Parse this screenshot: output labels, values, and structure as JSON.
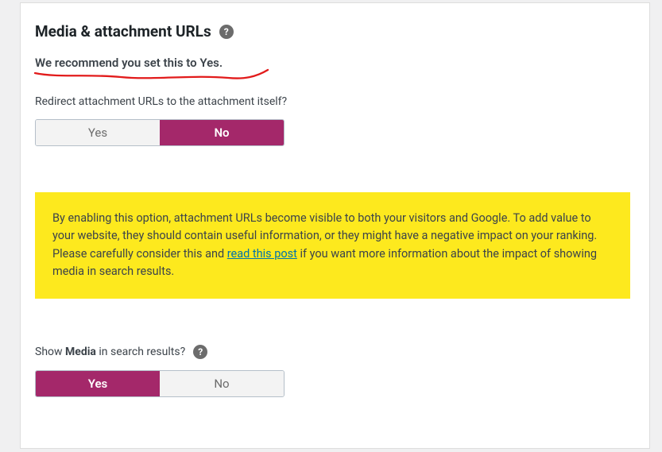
{
  "section": {
    "title": "Media & attachment URLs"
  },
  "recommend": "We recommend you set this to Yes.",
  "field1": {
    "label": "Redirect attachment URLs to the attachment itself?",
    "yes": "Yes",
    "no": "No",
    "active": "no"
  },
  "notice": {
    "text_before_link": "By enabling this option, attachment URLs become visible to both your visitors and Google. To add value to your website, they should contain useful information, or they might have a negative impact on your ranking. Please carefully consider this and ",
    "link_text": "read this post",
    "text_after_link": " if you want more information about the impact of showing media in search results."
  },
  "field2": {
    "label_prefix": "Show ",
    "label_bold": "Media",
    "label_suffix": " in search results?",
    "yes": "Yes",
    "no": "No",
    "active": "yes"
  }
}
